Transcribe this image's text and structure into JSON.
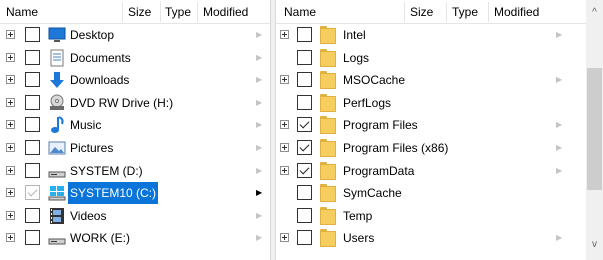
{
  "left_pane": {
    "columns": [
      "Name",
      "Size",
      "Type",
      "Modified"
    ],
    "rows": [
      {
        "label": "Desktop",
        "icon": "desktop-icon",
        "checked": false
      },
      {
        "label": "Documents",
        "icon": "documents-icon",
        "checked": false
      },
      {
        "label": "Downloads",
        "icon": "downloads-icon",
        "checked": false
      },
      {
        "label": "DVD RW Drive (H:)",
        "icon": "dvd-drive-icon",
        "checked": false
      },
      {
        "label": "Music",
        "icon": "music-icon",
        "checked": false
      },
      {
        "label": "Pictures",
        "icon": "pictures-icon",
        "checked": false
      },
      {
        "label": "SYSTEM (D:)",
        "icon": "drive-icon",
        "checked": false
      },
      {
        "label": "SYSTEM10 (C:)",
        "icon": "windows-drive-icon",
        "checked": true,
        "selected": true
      },
      {
        "label": "Videos",
        "icon": "videos-icon",
        "checked": false
      },
      {
        "label": "WORK (E:)",
        "icon": "drive-icon",
        "checked": false
      }
    ]
  },
  "right_pane": {
    "columns": [
      "Name",
      "Size",
      "Type",
      "Modified"
    ],
    "rows": [
      {
        "label": "Intel",
        "expander": true,
        "checked": false,
        "arrow": true
      },
      {
        "label": "Logs",
        "expander": false,
        "checked": false,
        "arrow": false
      },
      {
        "label": "MSOCache",
        "expander": true,
        "checked": false,
        "arrow": true
      },
      {
        "label": "PerfLogs",
        "expander": false,
        "checked": false,
        "arrow": false
      },
      {
        "label": "Program Files",
        "expander": true,
        "checked": true,
        "arrow": true
      },
      {
        "label": "Program Files (x86)",
        "expander": true,
        "checked": true,
        "arrow": true
      },
      {
        "label": "ProgramData",
        "expander": true,
        "checked": true,
        "arrow": true
      },
      {
        "label": "SymCache",
        "expander": false,
        "checked": false,
        "arrow": false
      },
      {
        "label": "Temp",
        "expander": false,
        "checked": false,
        "arrow": false
      },
      {
        "label": "Users",
        "expander": true,
        "checked": false,
        "arrow": true
      }
    ]
  },
  "scrollbar": {
    "up_arrow": "^",
    "down_arrow": "v"
  },
  "glyphs": {
    "expand_arrow": "▶"
  },
  "colors": {
    "selection": "#0a74d9",
    "folder": "#f6cd5f"
  }
}
